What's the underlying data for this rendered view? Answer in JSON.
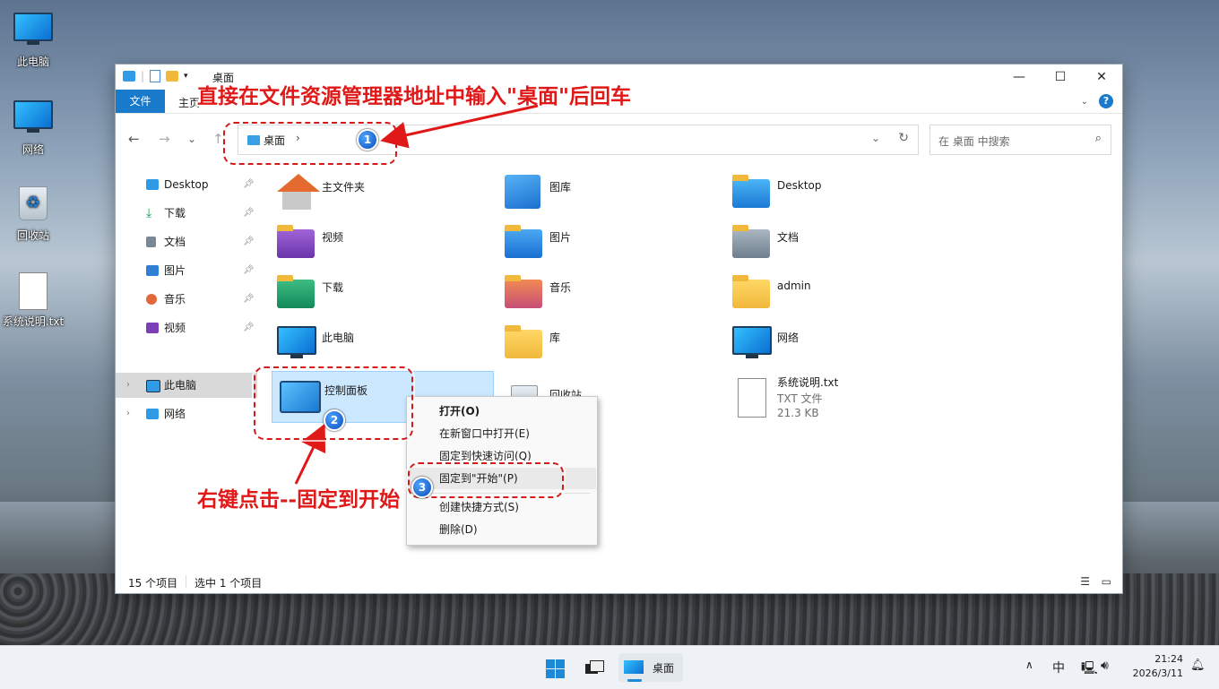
{
  "desktop": {
    "icons": [
      {
        "label": "此电脑",
        "icon": "computer-icon"
      },
      {
        "label": "网络",
        "icon": "network-icon"
      },
      {
        "label": "回收站",
        "icon": "recycle-bin-icon"
      },
      {
        "label": "系统说明.txt",
        "icon": "text-file-icon"
      }
    ]
  },
  "window": {
    "title": "桌面",
    "controls": {
      "minimize": "—",
      "maximize": "☐",
      "close": "✕"
    },
    "ribbon": {
      "file_tab": "文件",
      "home_tab": "主页"
    },
    "nav": {
      "back": "←",
      "forward": "→",
      "recent": "⌄",
      "up": "↑"
    },
    "address": {
      "segment": "桌面",
      "separator": "›"
    },
    "search": {
      "placeholder": "在 桌面 中搜索"
    },
    "sidebar": {
      "quick_access": [
        {
          "label": "Desktop",
          "icon": "desktop-icon",
          "color": "#2f9ae6"
        },
        {
          "label": "下载",
          "icon": "download-icon",
          "color": "#1f9a5a"
        },
        {
          "label": "文档",
          "icon": "document-icon",
          "color": "#7a8794"
        },
        {
          "label": "图片",
          "icon": "pictures-icon",
          "color": "#2f80d5"
        },
        {
          "label": "音乐",
          "icon": "music-icon",
          "color": "#e2683c"
        },
        {
          "label": "视频",
          "icon": "video-icon",
          "color": "#7c3fb8"
        }
      ],
      "tree": [
        {
          "label": "此电脑",
          "icon": "computer-icon",
          "selected": true
        },
        {
          "label": "网络",
          "icon": "network-icon",
          "selected": false
        }
      ]
    },
    "items": [
      {
        "name": "主文件夹",
        "icon": "home-icon"
      },
      {
        "name": "图库",
        "icon": "gallery-icon"
      },
      {
        "name": "Desktop",
        "icon": "desktop-folder-icon"
      },
      {
        "name": "视频",
        "icon": "videos-folder-icon"
      },
      {
        "name": "图片",
        "icon": "pictures-folder-icon"
      },
      {
        "name": "文档",
        "icon": "documents-folder-icon"
      },
      {
        "name": "下载",
        "icon": "downloads-folder-icon"
      },
      {
        "name": "音乐",
        "icon": "music-folder-icon"
      },
      {
        "name": "admin",
        "icon": "user-folder-icon"
      },
      {
        "name": "此电脑",
        "icon": "this-pc-icon"
      },
      {
        "name": "库",
        "icon": "library-folder-icon"
      },
      {
        "name": "网络",
        "icon": "network-icon"
      },
      {
        "name": "控制面板",
        "icon": "control-panel-icon"
      },
      {
        "name": "回收站",
        "icon": "recycle-bin-icon"
      },
      {
        "name": "系统说明.txt",
        "icon": "text-file-icon",
        "type": "TXT 文件",
        "size": "21.3 KB"
      }
    ],
    "status": {
      "count": "15 个项目",
      "selected": "选中 1 个项目"
    }
  },
  "context_menu": {
    "items": [
      {
        "label": "打开(O)",
        "bold": true
      },
      {
        "label": "在新窗口中打开(E)"
      },
      {
        "label": "固定到快速访问(Q)"
      },
      {
        "label": "固定到\"开始\"(P)",
        "highlighted": true
      },
      {
        "label": "创建快捷方式(S)"
      },
      {
        "label": "删除(D)"
      }
    ]
  },
  "annotations": {
    "top_text": "直接在文件资源管理器地址中输入\"桌面\"后回车",
    "bottom_text": "右键点击--固定到开始",
    "badges": [
      "1",
      "2",
      "3"
    ],
    "color": "#e01818"
  },
  "taskbar": {
    "start_icon": "windows-start-icon",
    "taskview_icon": "task-view-icon",
    "app_label": "桌面",
    "tray": {
      "chevron": "∧",
      "ime": "中"
    },
    "time": "21:24",
    "date": "2026/3/11"
  }
}
